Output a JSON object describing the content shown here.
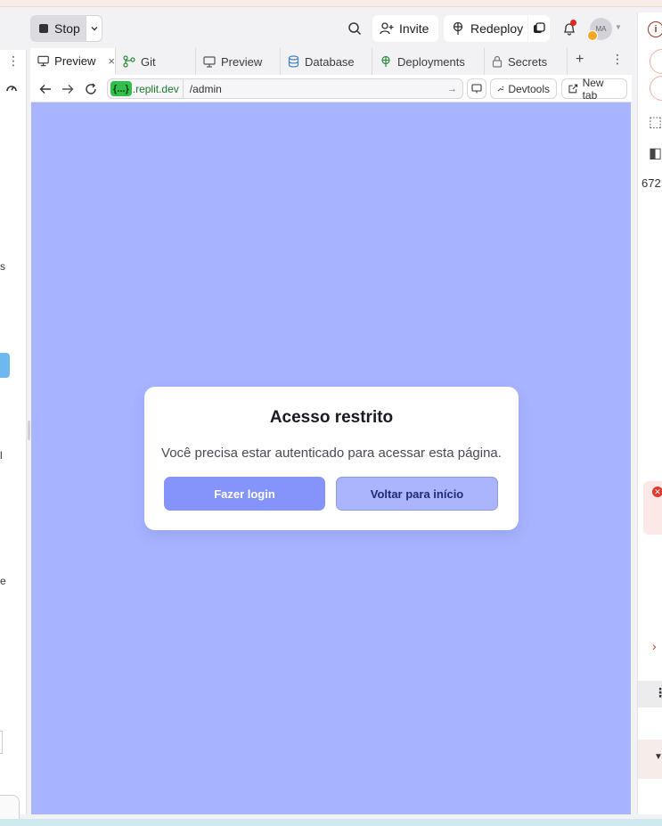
{
  "topbar": {
    "stop_label": "Stop",
    "invite_label": "Invite",
    "redeploy_label": "Redeploy",
    "avatar_initials": "MA"
  },
  "tabs": [
    {
      "label": "Preview",
      "icon": "monitor-icon",
      "active": true,
      "close": "×"
    },
    {
      "label": "Git",
      "icon": "git-icon"
    },
    {
      "label": "Preview",
      "icon": "monitor-icon"
    },
    {
      "label": "Database",
      "icon": "database-icon"
    },
    {
      "label": "Deployments",
      "icon": "deployments-icon"
    },
    {
      "label": "Secrets",
      "icon": "lock-icon"
    }
  ],
  "tabbar": {
    "plus": "+",
    "more": "⋮"
  },
  "addressbar": {
    "url_badge": "{...}",
    "url_domain": ".replit.dev",
    "url_path": "/admin",
    "devtools_label": "Devtools",
    "newtab_label": "New tab"
  },
  "page": {
    "background": "#a8b4ff",
    "title": "Acesso restrito",
    "message": "Você precisa estar autenticado para acessar esta página.",
    "login_label": "Fazer login",
    "home_label": "Voltar para início"
  },
  "left_panel": {
    "frag_1": "s",
    "frag_2": "y",
    "frag_3": "l",
    "frag_4": "e"
  },
  "right_panel": {
    "info": "i",
    "number": "672"
  },
  "colors": {
    "accent": "#8594fb",
    "preview_bg": "#a8b4ff",
    "url_badge": "#2fbf4a",
    "notification": "#e0261a"
  }
}
